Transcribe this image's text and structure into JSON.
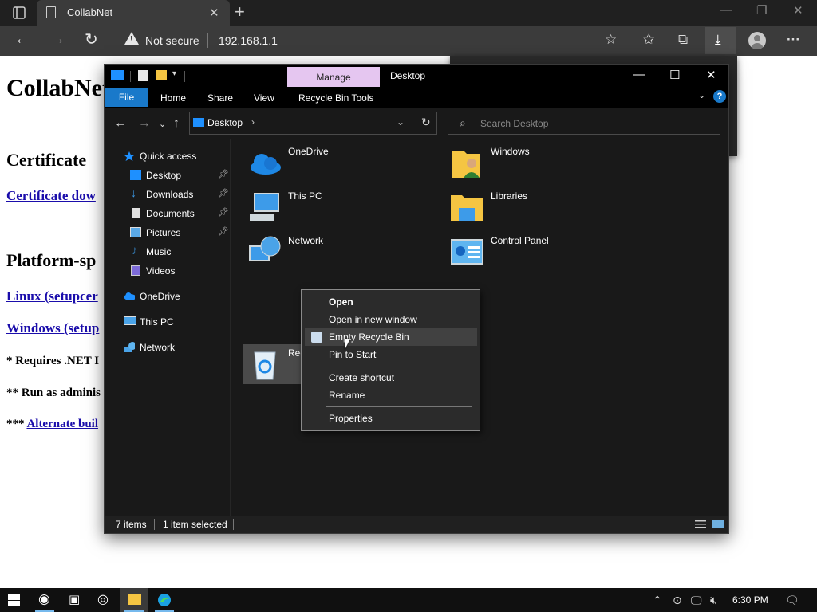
{
  "browser": {
    "tab_title": "CollabNet",
    "security_label": "Not secure",
    "url": "192.168.1.1"
  },
  "webpage": {
    "title": "CollabNet",
    "h_certificate": "Certificate",
    "link_certificate": "Certificate dow",
    "h_platform": "Platform-sp",
    "link_linux": "Linux (setupcer",
    "link_windows": "Windows (setup",
    "note1": "* Requires .NET I",
    "note2": "** Run as adminis",
    "note3_prefix": "*** ",
    "note3_link": "Alternate buil"
  },
  "explorer": {
    "title": "Desktop",
    "manage_tab": "Manage",
    "ribbon_tabs": [
      "File",
      "Home",
      "Share",
      "View",
      "Recycle Bin Tools"
    ],
    "address": "Desktop",
    "search_placeholder": "Search Desktop",
    "nav": [
      {
        "label": "Quick access"
      },
      {
        "label": "Desktop"
      },
      {
        "label": "Downloads"
      },
      {
        "label": "Documents"
      },
      {
        "label": "Pictures"
      },
      {
        "label": "Music"
      },
      {
        "label": "Videos"
      },
      {
        "label": "OneDrive"
      },
      {
        "label": "This PC"
      },
      {
        "label": "Network"
      }
    ],
    "items": [
      {
        "label": "OneDrive"
      },
      {
        "label": "Windows"
      },
      {
        "label": "This PC"
      },
      {
        "label": "Libraries"
      },
      {
        "label": "Network"
      },
      {
        "label": "Control Panel"
      },
      {
        "label": "Recycle Bin"
      }
    ],
    "status_items": "7 items",
    "status_selected": "1 item selected"
  },
  "context_menu": {
    "items": [
      "Open",
      "Open in new window",
      "Empty Recycle Bin",
      "Pin to Start",
      "Create shortcut",
      "Rename",
      "Properties"
    ]
  },
  "taskbar": {
    "clock": "6:30 PM"
  },
  "colors": {
    "accent": "#1979ca",
    "manage_tab": "#e5c6f0",
    "link": "#1a0dab"
  }
}
